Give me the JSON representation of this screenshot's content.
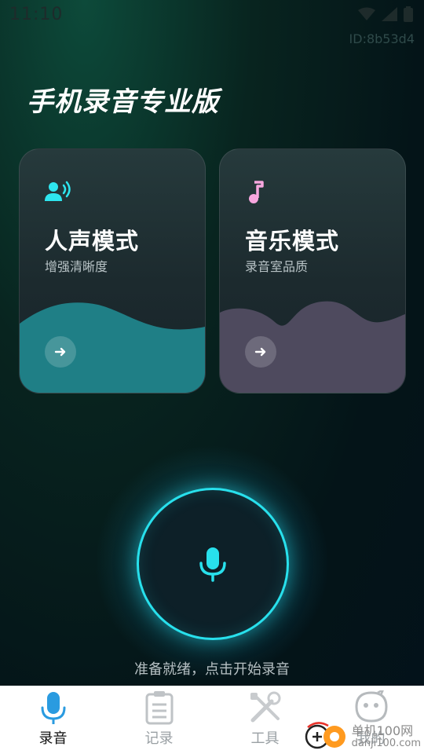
{
  "status_bar": {
    "time": "11:10"
  },
  "device_id": "ID:8b53d4",
  "app_title": "手机录音专业版",
  "cards": [
    {
      "title": "人声模式",
      "subtitle": "增强清晰度",
      "icon": "voice-icon",
      "accent": "#1f7f86"
    },
    {
      "title": "音乐模式",
      "subtitle": "录音室品质",
      "icon": "music-note-icon",
      "accent": "#4e4a5e"
    }
  ],
  "record": {
    "status_text": "准备就绪，点击开始录音",
    "ring_color": "#28e0ec"
  },
  "tabs": [
    {
      "label": "录音",
      "icon": "mic-icon",
      "active": true
    },
    {
      "label": "记录",
      "icon": "clipboard-icon",
      "active": false
    },
    {
      "label": "工具",
      "icon": "tools-icon",
      "active": false
    },
    {
      "label": "我的",
      "icon": "profile-icon",
      "active": false
    }
  ],
  "watermark": {
    "brand": "单机100网",
    "url": "danji100.com"
  }
}
